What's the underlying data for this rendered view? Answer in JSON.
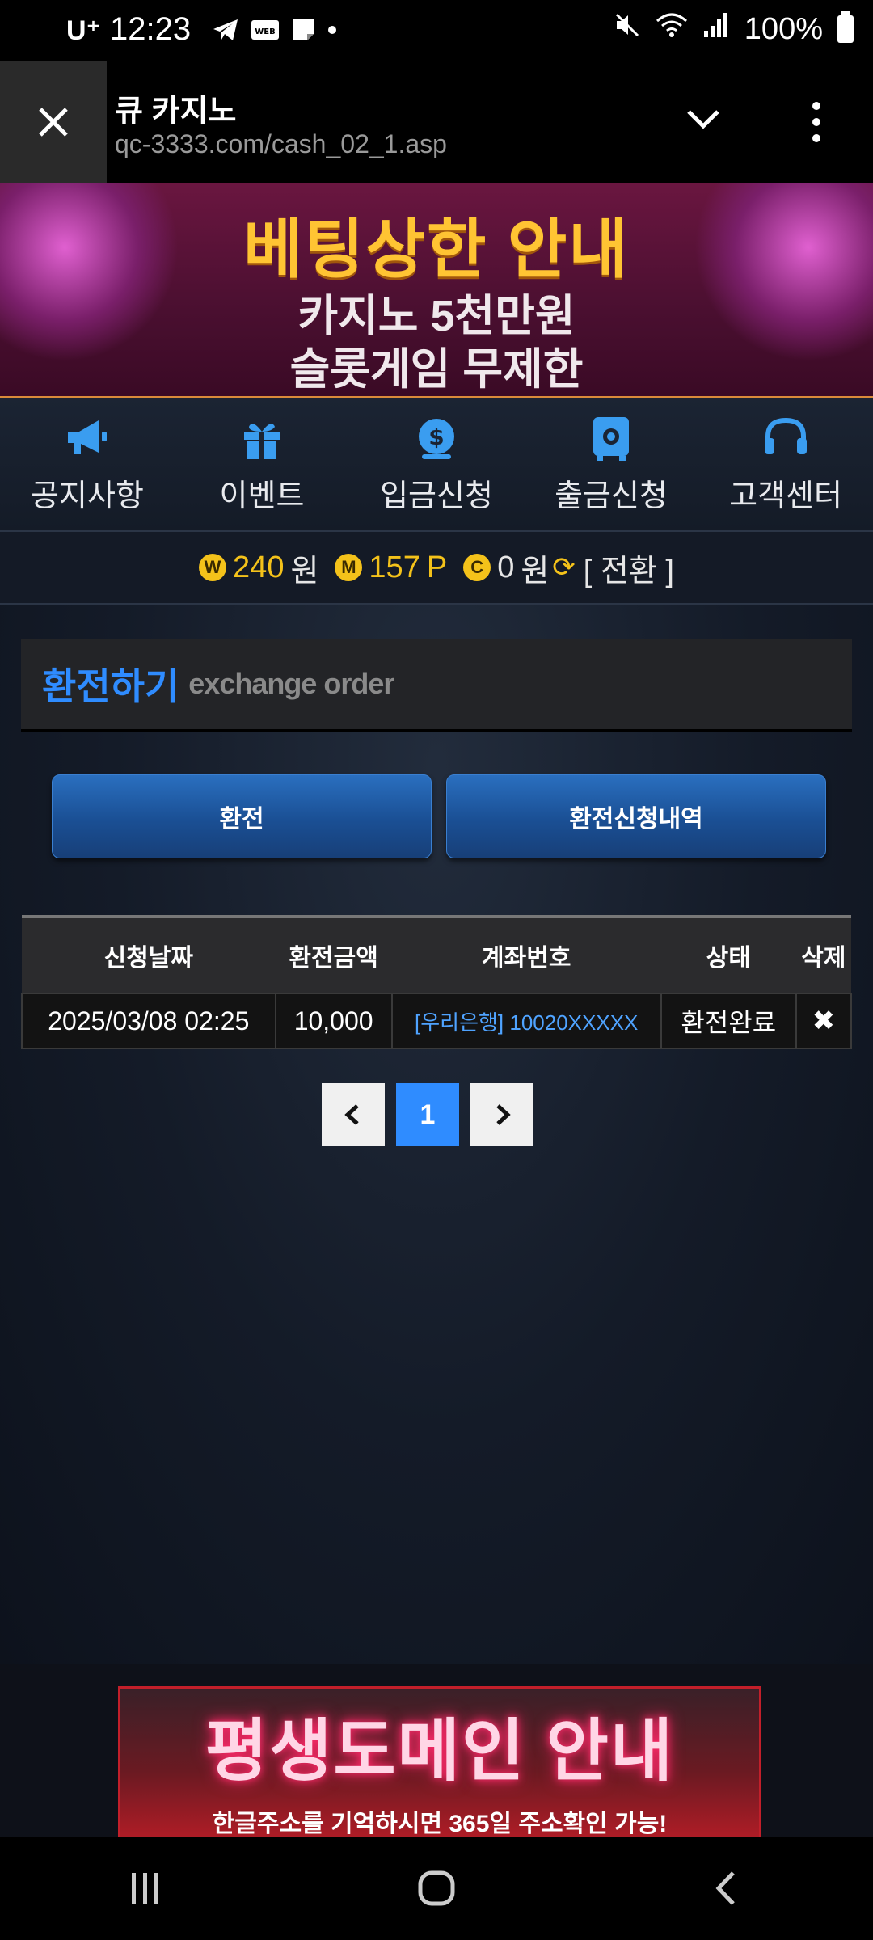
{
  "status_bar": {
    "carrier": "U⁺",
    "time": "12:23",
    "battery": "100%",
    "icons": [
      "telegram-icon",
      "webtoon-icon",
      "note-icon",
      "dot-icon",
      "mute-icon",
      "wifi-icon",
      "signal-icon",
      "battery-icon"
    ]
  },
  "browser": {
    "title": "큐 카지노",
    "url": "qc-3333.com/cash_02_1.asp"
  },
  "top_banner": {
    "headline": "베팅상한 안내",
    "line1": "카지노 5천만원",
    "line2": "슬롯게임 무제한"
  },
  "nav": {
    "items": [
      {
        "label": "공지사항",
        "icon": "megaphone-icon"
      },
      {
        "label": "이벤트",
        "icon": "gift-icon"
      },
      {
        "label": "입금신청",
        "icon": "dollar-coin-icon"
      },
      {
        "label": "출금신청",
        "icon": "safe-icon"
      },
      {
        "label": "고객센터",
        "icon": "headset-icon"
      }
    ]
  },
  "balance": {
    "won_badge": "W",
    "won_amount": "240",
    "won_unit": "원",
    "point_badge": "M",
    "point_amount": "157",
    "point_unit": "P",
    "coin_badge": "C",
    "coin_amount": "0",
    "coin_unit": "원",
    "switch_label": "[ 전환 ]"
  },
  "section": {
    "title": "환전하기",
    "subtitle": "exchange order"
  },
  "buttons": {
    "exchange": "환전",
    "history": "환전신청내역"
  },
  "table": {
    "headers": [
      "신청날짜",
      "환전금액",
      "계좌번호",
      "상태",
      "삭제"
    ],
    "rows": [
      {
        "date": "2025/03/08 02:25",
        "amount": "10,000",
        "account": "[우리은행] 10020XXXXX",
        "status": "환전완료"
      }
    ]
  },
  "pagination": {
    "current": "1"
  },
  "bottom_banner": {
    "title": "평생도메인 안내",
    "subtitle": "한글주소를 기억하시면 365일 주소확인 가능!"
  },
  "colors": {
    "accent_blue": "#2f8cff",
    "gold": "#f4c21a",
    "banner_yellow": "#ffc433"
  }
}
